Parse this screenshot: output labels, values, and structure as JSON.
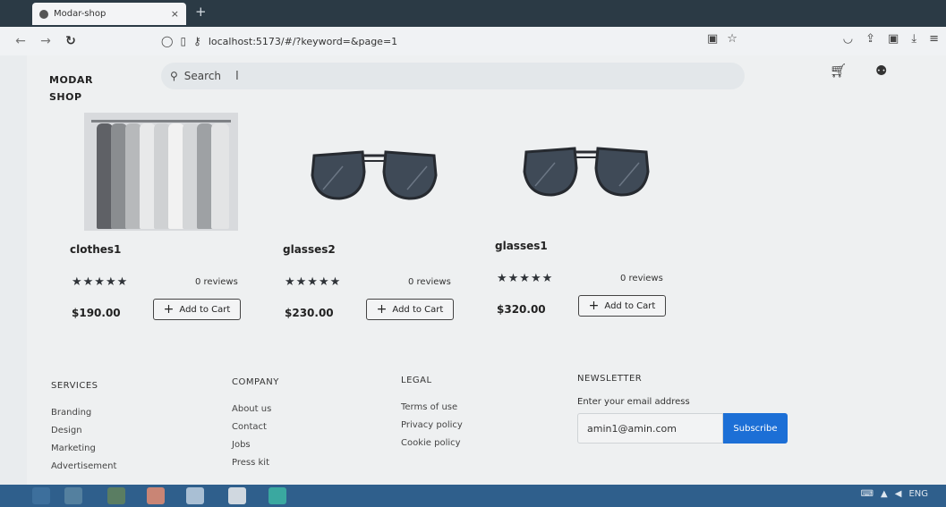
{
  "browser": {
    "tab_title": "Modar-shop",
    "tab_close": "×",
    "new_tab": "+",
    "url": "localhost:5173/#/?keyword=&page=1"
  },
  "header": {
    "logo_line1": "MODAR",
    "logo_line2": "SHOP",
    "search_placeholder": "Search"
  },
  "products": [
    {
      "name": "clothes1",
      "rating": 5,
      "stars": "★★★★★",
      "reviews": "0 reviews",
      "price": "$190.00",
      "cart_label": "Add to Cart",
      "image": "clothes-rack"
    },
    {
      "name": "glasses2",
      "rating": 5,
      "stars": "★★★★★",
      "reviews": "0 reviews",
      "price": "$230.00",
      "cart_label": "Add to Cart",
      "image": "sunglasses"
    },
    {
      "name": "glasses1",
      "rating": 5,
      "stars": "★★★★★",
      "reviews": "0 reviews",
      "price": "$320.00",
      "cart_label": "Add to Cart",
      "image": "sunglasses"
    }
  ],
  "footer": {
    "services": {
      "heading": "SERVICES",
      "links": [
        "Branding",
        "Design",
        "Marketing",
        "Advertisement"
      ]
    },
    "company": {
      "heading": "COMPANY",
      "links": [
        "About us",
        "Contact",
        "Jobs",
        "Press kit"
      ]
    },
    "legal": {
      "heading": "LEGAL",
      "links": [
        "Terms of use",
        "Privacy policy",
        "Cookie policy"
      ]
    },
    "newsletter": {
      "heading": "NEWSLETTER",
      "label": "Enter your email address",
      "email_value": "amin1@amin.com",
      "button": "Subscribe"
    }
  },
  "taskbar": {
    "language": "ENG"
  },
  "colors": {
    "accent": "#1c6fd6",
    "taskbar": "#2f5f8c"
  }
}
